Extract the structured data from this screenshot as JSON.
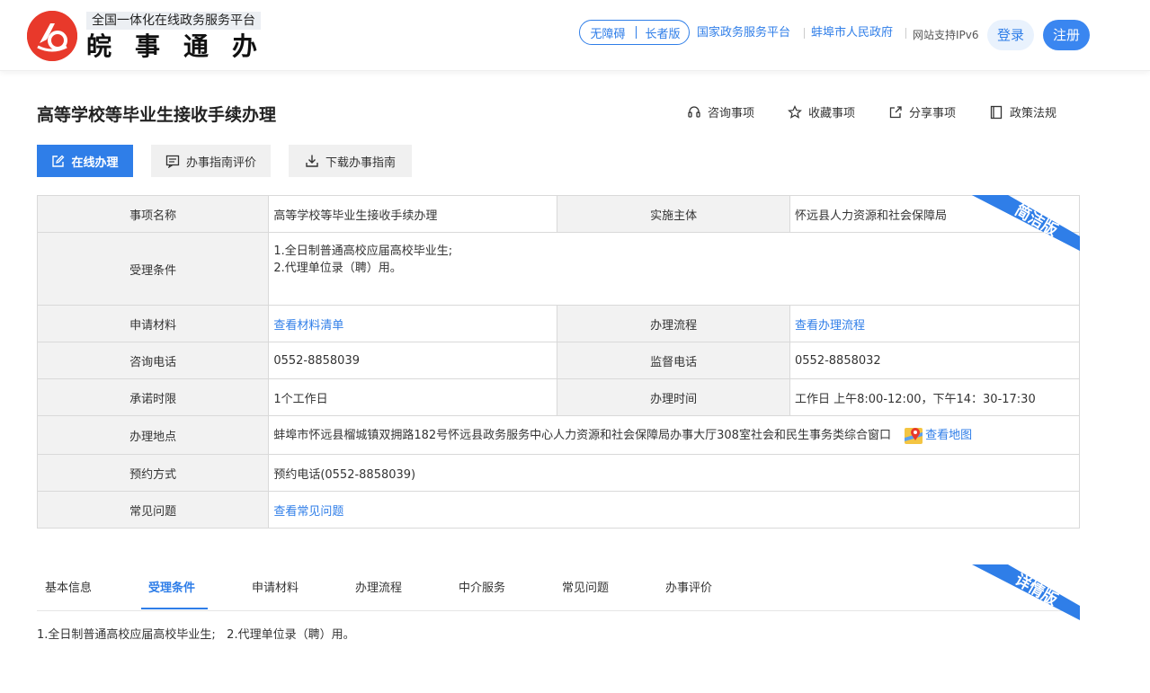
{
  "header": {
    "logo_icon": "anhui-logo-icon",
    "platform_subtitle": "全国一体化在线政务服务平台",
    "brand_name": "皖事通办",
    "accessibility_label": "无障碍",
    "elder_label": "长者版",
    "national_platform_link": "国家政务服务平台",
    "city_gov_link": "蚌埠市人民政府",
    "ipv6_text": "网站支持IPv6",
    "login_label": "登录",
    "register_label": "注册",
    "accent_color": "#2f7ee8"
  },
  "title_row": {
    "title": "高等学校等毕业生接收手续办理",
    "actions": [
      {
        "icon": "headset-icon",
        "label": "咨询事项"
      },
      {
        "icon": "star-icon",
        "label": "收藏事项"
      },
      {
        "icon": "share-icon",
        "label": "分享事项"
      },
      {
        "icon": "book-icon",
        "label": "政策法规"
      }
    ]
  },
  "buttons": {
    "online": "在线办理",
    "evaluate": "办事指南评价",
    "download": "下载办事指南"
  },
  "table": {
    "ribbon": "简洁版",
    "item_name_label": "事项名称",
    "item_name": "高等学校等毕业生接收手续办理",
    "subject_label": "实施主体",
    "subject": "怀远县人力资源和社会保障局",
    "conditions_label": "受理条件",
    "conditions": [
      "1.全日制普通高校应届高校毕业生;",
      "2.代理单位录（聘）用。"
    ],
    "materials_label": "申请材料",
    "materials_link": "查看材料清单",
    "process_label": "办理流程",
    "process_link": "查看办理流程",
    "consult_phone_label": "咨询电话",
    "consult_phone": "0552-8858039",
    "supervise_phone_label": "监督电话",
    "supervise_phone": "0552-8858032",
    "time_limit_label": "承诺时限",
    "time_limit": "1个工作日",
    "office_hours_label": "办理时间",
    "office_hours": "工作日 上午8:00-12:00，下午14：30-17:30",
    "location_label": "办理地点",
    "location": "蚌埠市怀远县榴城镇双拥路182号怀远县政务服务中心人力资源和社会保障局办事大厅308室社会和民生事务类综合窗口",
    "map_link": "查看地图",
    "booking_label": "预约方式",
    "booking": "预约电话(0552-8858039)",
    "faq_label": "常见问题",
    "faq_link": "查看常见问题"
  },
  "tabs": {
    "ribbon": "详情版",
    "items": [
      "基本信息",
      "受理条件",
      "申请材料",
      "办理流程",
      "中介服务",
      "常见问题",
      "办事评价"
    ],
    "active_index": 1,
    "content": "1.全日制普通高校应届高校毕业生;   2.代理单位录（聘）用。"
  }
}
